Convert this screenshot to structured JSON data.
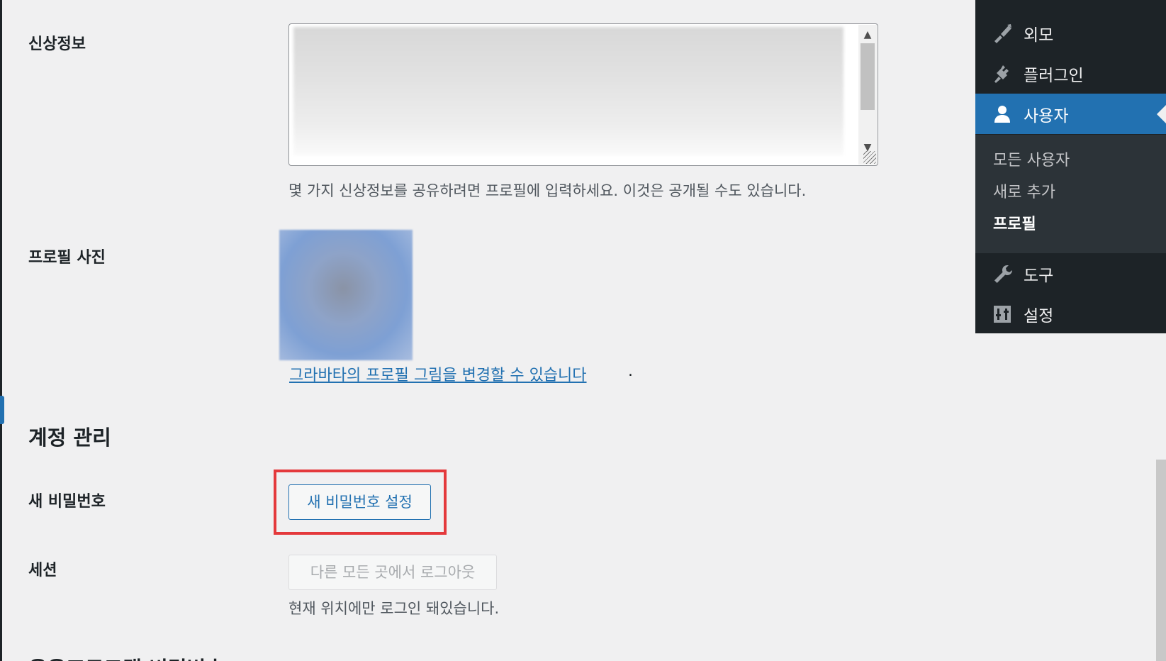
{
  "profile": {
    "bio": {
      "label": "신상정보",
      "description": "몇 가지 신상정보를 공유하려면 프로필에 입력하세요. 이것은 공개될 수도 있습니다."
    },
    "picture": {
      "label": "프로필 사진",
      "link_text": "그라바타의 프로필 그림을 변경할 수 있습니다",
      "link_suffix": "."
    }
  },
  "account": {
    "heading": "계정 관리",
    "new_password": {
      "label": "새 비밀번호",
      "button_label": "새 비밀번호 설정"
    },
    "sessions": {
      "label": "세션",
      "button_label": "다른 모든 곳에서 로그아웃",
      "description": "현재 위치에만 로그인 돼있습니다."
    }
  },
  "next_section_heading": "응용프로그램 비밀번호",
  "admin_menu": {
    "items": [
      {
        "label": "외모",
        "icon": "paintbrush-icon"
      },
      {
        "label": "플러그인",
        "icon": "plugin-icon"
      },
      {
        "label": "사용자",
        "icon": "user-icon",
        "active": true
      },
      {
        "label": "도구",
        "icon": "wrench-icon"
      },
      {
        "label": "설정",
        "icon": "settings-sliders-icon"
      }
    ],
    "submenu": [
      {
        "label": "모든 사용자"
      },
      {
        "label": "새로 추가"
      },
      {
        "label": "프로필",
        "current": true
      }
    ]
  },
  "colors": {
    "accent": "#2271b1",
    "highlight_border": "#e4393c",
    "menu_bg": "#1d2327",
    "submenu_bg": "#2c3338",
    "page_bg": "#f0f0f1"
  }
}
